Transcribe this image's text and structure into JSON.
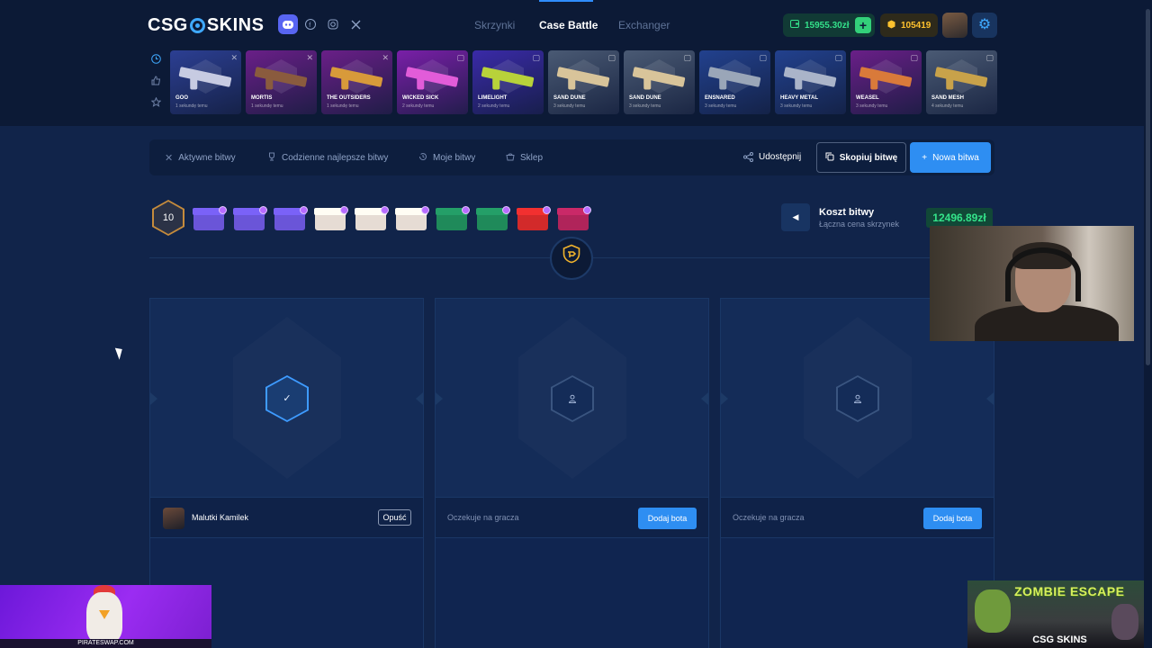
{
  "header": {
    "logo_left": "CSG",
    "logo_right": "SKINS",
    "nav": [
      {
        "label": "Skrzynki",
        "active": false
      },
      {
        "label": "Case Battle",
        "active": true
      },
      {
        "label": "Exchanger",
        "active": false
      }
    ],
    "balance": "15955.30zł",
    "coins": "105419",
    "social_icons": [
      "discord-icon",
      "facebook-icon",
      "instagram-icon",
      "x-icon"
    ]
  },
  "live_drops": [
    {
      "name": "GOO",
      "time": "1 sekundę temu",
      "color": "#2c3f93",
      "gun": "#c7cbe2"
    },
    {
      "name": "MORTIS",
      "time": "1 sekundę temu",
      "color": "#6a1f88",
      "gun": "#8a5b3e"
    },
    {
      "name": "THE OUTSIDERS",
      "time": "1 sekundę temu",
      "color": "#6a1f88",
      "gun": "#d89a3a"
    },
    {
      "name": "WICKED SICK",
      "time": "2 sekundy temu",
      "color": "#7a1fa8",
      "gun": "#e25cd9"
    },
    {
      "name": "LIMELIGHT",
      "time": "2 sekundy temu",
      "color": "#3a2aa8",
      "gun": "#b8d23a"
    },
    {
      "name": "SAND DUNE",
      "time": "3 sekundy temu",
      "color": "#4a5a74",
      "gun": "#d8c49a"
    },
    {
      "name": "SAND DUNE",
      "time": "3 sekundy temu",
      "color": "#4a5a74",
      "gun": "#d8c49a"
    },
    {
      "name": "ENSNARED",
      "time": "3 sekundy temu",
      "color": "#22418e",
      "gun": "#9aa6b8"
    },
    {
      "name": "HEAVY METAL",
      "time": "3 sekundy temu",
      "color": "#22418e",
      "gun": "#aab4c9"
    },
    {
      "name": "WEASEL",
      "time": "3 sekundy temu",
      "color": "#6a1f88",
      "gun": "#d97a3a"
    },
    {
      "name": "SAND MESH",
      "time": "4 sekundy temu",
      "color": "#4a5a74",
      "gun": "#c8a24a"
    }
  ],
  "toolbar": {
    "tabs": [
      {
        "label": "Aktywne bitwy",
        "icon": "swords-icon"
      },
      {
        "label": "Codzienne najlepsze bitwy",
        "icon": "trophy-icon"
      },
      {
        "label": "Moje bitwy",
        "icon": "history-icon"
      },
      {
        "label": "Sklep",
        "icon": "shop-icon"
      }
    ],
    "share": "Udostępnij",
    "copy": "Skopiuj bitwę",
    "new": "Nowa bitwa"
  },
  "battle": {
    "rounds": "10",
    "cases": [
      {
        "color": "#6a55d8"
      },
      {
        "color": "#6a55d8"
      },
      {
        "color": "#6a55d8"
      },
      {
        "color": "#e6dcd4"
      },
      {
        "color": "#e6dcd4"
      },
      {
        "color": "#e6dcd4"
      },
      {
        "color": "#1f8a5a"
      },
      {
        "color": "#1f8a5a"
      },
      {
        "color": "#d22a2a"
      },
      {
        "color": "#b0245a"
      }
    ],
    "cost_title": "Koszt bitwy",
    "cost_sub": "Łączna cena skrzynek",
    "cost_value": "12496.89zł"
  },
  "players": [
    {
      "name": "Malutki Kamilek",
      "action": "Opuść",
      "ready": true
    },
    {
      "waiting": "Oczekuje na gracza",
      "action": "Dodaj bota"
    },
    {
      "waiting": "Oczekuje na gracza",
      "action": "Dodaj bota"
    }
  ],
  "ads": {
    "left": "PIRATESWAP.COM",
    "right_title": "ZOMBIE ESCAPE",
    "right_brand": "CSG SKINS"
  }
}
